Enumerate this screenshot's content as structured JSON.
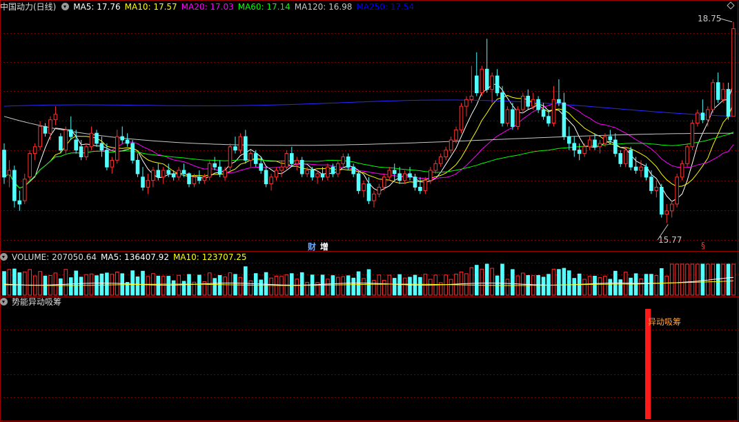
{
  "header": {
    "title": "中国动力(日线)",
    "ma": [
      {
        "label": "MA5: 17.76",
        "color": "#ffffff"
      },
      {
        "label": "MA10: 17.57",
        "color": "#ffff00"
      },
      {
        "label": "MA20: 17.03",
        "color": "#ff00ff"
      },
      {
        "label": "MA60: 17.14",
        "color": "#00ff00"
      },
      {
        "label": "MA120: 16.98",
        "color": "#c8c8c8"
      },
      {
        "label": "MA250: 17.54",
        "color": "#0000ff"
      }
    ]
  },
  "volume_header": {
    "label": "VOLUME: 207050.64",
    "ma5": "MA5: 136407.92",
    "ma10": "MA10: 123707.25"
  },
  "indicator_header": {
    "label": "势能异动吸筹"
  },
  "annotations": {
    "high": "18.75",
    "low": "15.77",
    "cai": "财",
    "zeng": "增",
    "s": "§",
    "signal": "异动吸筹"
  },
  "colors": {
    "up": "#ff3232",
    "down": "#54ffff",
    "grid": "#7a0000",
    "border": "#a00000"
  },
  "chart_data": {
    "type": "candlestick",
    "title": "中国动力(日线)",
    "y_high_label": 18.75,
    "y_low_label": 15.77,
    "candles": [
      [
        16.85,
        16.95,
        16.35,
        16.45
      ],
      [
        16.48,
        16.7,
        16.3,
        16.55
      ],
      [
        16.55,
        16.62,
        16.0,
        16.1
      ],
      [
        16.1,
        16.25,
        15.95,
        16.05
      ],
      [
        16.1,
        16.5,
        16.05,
        16.42
      ],
      [
        16.45,
        16.85,
        16.4,
        16.8
      ],
      [
        16.8,
        16.95,
        16.7,
        16.9
      ],
      [
        16.9,
        17.28,
        16.85,
        17.2
      ],
      [
        17.2,
        17.25,
        17.05,
        17.1
      ],
      [
        17.1,
        17.35,
        17.0,
        17.3
      ],
      [
        17.3,
        17.5,
        17.22,
        17.38
      ],
      [
        17.05,
        17.1,
        16.8,
        16.85
      ],
      [
        16.85,
        17.2,
        16.8,
        17.15
      ],
      [
        17.15,
        17.35,
        17.0,
        17.05
      ],
      [
        17.0,
        17.15,
        16.8,
        16.85
      ],
      [
        16.9,
        17.0,
        16.7,
        16.75
      ],
      [
        16.75,
        16.95,
        16.7,
        16.9
      ],
      [
        16.9,
        17.2,
        16.85,
        17.1
      ],
      [
        17.1,
        17.15,
        16.9,
        16.95
      ],
      [
        16.95,
        17.05,
        16.75,
        16.85
      ],
      [
        16.85,
        16.95,
        16.55,
        16.6
      ],
      [
        16.6,
        16.75,
        16.5,
        16.7
      ],
      [
        16.7,
        17.15,
        16.65,
        17.05
      ],
      [
        17.05,
        17.2,
        16.95,
        17.0
      ],
      [
        17.0,
        17.1,
        16.9,
        16.95
      ],
      [
        16.95,
        17.0,
        16.65,
        16.7
      ],
      [
        16.7,
        16.8,
        16.45,
        16.5
      ],
      [
        16.45,
        16.6,
        16.25,
        16.3
      ],
      [
        16.3,
        16.5,
        16.2,
        16.4
      ],
      [
        16.4,
        16.6,
        16.3,
        16.55
      ],
      [
        16.55,
        16.65,
        16.4,
        16.45
      ],
      [
        16.45,
        16.6,
        16.35,
        16.55
      ],
      [
        16.55,
        16.65,
        16.45,
        16.5
      ],
      [
        16.5,
        16.55,
        16.4,
        16.45
      ],
      [
        16.45,
        16.6,
        16.4,
        16.55
      ],
      [
        16.55,
        16.65,
        16.45,
        16.5
      ],
      [
        16.5,
        16.52,
        16.3,
        16.35
      ],
      [
        16.35,
        16.5,
        16.3,
        16.45
      ],
      [
        16.45,
        16.55,
        16.35,
        16.4
      ],
      [
        16.4,
        16.5,
        16.35,
        16.45
      ],
      [
        16.45,
        16.7,
        16.4,
        16.65
      ],
      [
        16.65,
        16.75,
        16.55,
        16.6
      ],
      [
        16.6,
        16.7,
        16.45,
        16.5
      ],
      [
        16.45,
        16.6,
        16.4,
        16.55
      ],
      [
        16.6,
        16.95,
        16.55,
        16.9
      ],
      [
        16.9,
        17.05,
        16.8,
        16.85
      ],
      [
        16.85,
        17.1,
        16.8,
        17.05
      ],
      [
        17.05,
        17.15,
        16.65,
        16.7
      ],
      [
        16.7,
        16.85,
        16.6,
        16.8
      ],
      [
        16.8,
        16.85,
        16.6,
        16.65
      ],
      [
        16.65,
        16.75,
        16.5,
        16.55
      ],
      [
        16.55,
        16.6,
        16.3,
        16.35
      ],
      [
        16.35,
        16.5,
        16.25,
        16.45
      ],
      [
        16.45,
        16.6,
        16.4,
        16.55
      ],
      [
        16.55,
        16.7,
        16.45,
        16.6
      ],
      [
        16.6,
        16.85,
        16.55,
        16.8
      ],
      [
        16.8,
        16.9,
        16.6,
        16.65
      ],
      [
        16.65,
        16.75,
        16.55,
        16.7
      ],
      [
        16.7,
        16.75,
        16.45,
        16.5
      ],
      [
        16.5,
        16.6,
        16.45,
        16.55
      ],
      [
        16.55,
        16.6,
        16.4,
        16.45
      ],
      [
        16.45,
        16.55,
        16.35,
        16.5
      ],
      [
        16.5,
        16.6,
        16.4,
        16.45
      ],
      [
        16.45,
        16.65,
        16.4,
        16.6
      ],
      [
        16.6,
        16.65,
        16.45,
        16.5
      ],
      [
        16.5,
        16.7,
        16.45,
        16.65
      ],
      [
        16.65,
        16.8,
        16.6,
        16.75
      ],
      [
        16.75,
        16.8,
        16.55,
        16.6
      ],
      [
        16.6,
        16.65,
        16.45,
        16.5
      ],
      [
        16.5,
        16.55,
        16.2,
        16.25
      ],
      [
        16.25,
        16.4,
        16.15,
        16.35
      ],
      [
        16.35,
        16.45,
        16.05,
        16.1
      ],
      [
        16.1,
        16.25,
        16.0,
        16.2
      ],
      [
        16.2,
        16.35,
        16.15,
        16.3
      ],
      [
        16.3,
        16.5,
        16.25,
        16.45
      ],
      [
        16.45,
        16.6,
        16.4,
        16.55
      ],
      [
        16.55,
        16.65,
        16.4,
        16.5
      ],
      [
        16.5,
        16.6,
        16.35,
        16.4
      ],
      [
        16.4,
        16.55,
        16.35,
        16.5
      ],
      [
        16.5,
        16.6,
        16.4,
        16.45
      ],
      [
        16.45,
        16.5,
        16.25,
        16.3
      ],
      [
        16.3,
        16.45,
        16.2,
        16.25
      ],
      [
        16.25,
        16.45,
        16.2,
        16.4
      ],
      [
        16.4,
        16.6,
        16.35,
        16.55
      ],
      [
        16.55,
        16.7,
        16.5,
        16.65
      ],
      [
        16.65,
        16.8,
        16.6,
        16.75
      ],
      [
        16.75,
        16.9,
        16.7,
        16.85
      ],
      [
        16.85,
        17.05,
        16.8,
        17.0
      ],
      [
        17.0,
        17.2,
        16.95,
        17.15
      ],
      [
        17.15,
        17.55,
        17.1,
        17.5
      ],
      [
        17.5,
        17.65,
        17.35,
        17.6
      ],
      [
        17.6,
        18.1,
        17.55,
        17.65
      ],
      [
        17.95,
        18.3,
        17.65,
        17.7
      ],
      [
        17.7,
        18.1,
        17.65,
        18.05
      ],
      [
        18.05,
        18.5,
        17.7,
        17.75
      ],
      [
        17.75,
        18.0,
        17.55,
        17.95
      ],
      [
        17.95,
        18.05,
        17.65,
        17.7
      ],
      [
        17.7,
        17.8,
        17.2,
        17.25
      ],
      [
        17.25,
        17.5,
        17.2,
        17.45
      ],
      [
        17.45,
        17.55,
        17.15,
        17.2
      ],
      [
        17.2,
        17.5,
        17.15,
        17.45
      ],
      [
        17.45,
        17.7,
        17.4,
        17.65
      ],
      [
        17.65,
        17.75,
        17.45,
        17.5
      ],
      [
        17.5,
        17.7,
        17.45,
        17.6
      ],
      [
        17.6,
        17.65,
        17.4,
        17.45
      ],
      [
        17.45,
        17.55,
        17.3,
        17.35
      ],
      [
        17.35,
        17.45,
        17.2,
        17.25
      ],
      [
        17.25,
        17.8,
        17.2,
        17.6
      ],
      [
        17.6,
        17.9,
        17.5,
        17.55
      ],
      [
        17.55,
        17.7,
        17.0,
        17.05
      ],
      [
        17.05,
        17.2,
        16.85,
        16.95
      ],
      [
        16.95,
        17.05,
        16.75,
        16.85
      ],
      [
        16.85,
        16.95,
        16.7,
        16.8
      ],
      [
        16.8,
        16.95,
        16.75,
        16.9
      ],
      [
        16.9,
        17.05,
        16.85,
        17.0
      ],
      [
        17.0,
        17.1,
        16.85,
        16.9
      ],
      [
        16.9,
        17.0,
        16.8,
        16.95
      ],
      [
        16.95,
        17.1,
        16.9,
        17.05
      ],
      [
        17.05,
        17.15,
        16.95,
        17.0
      ],
      [
        17.0,
        17.1,
        16.75,
        16.8
      ],
      [
        16.8,
        16.85,
        16.6,
        16.65
      ],
      [
        16.65,
        16.9,
        16.6,
        16.85
      ],
      [
        16.85,
        16.9,
        16.55,
        16.6
      ],
      [
        16.6,
        16.75,
        16.5,
        16.55
      ],
      [
        16.55,
        16.7,
        16.45,
        16.6
      ],
      [
        16.6,
        16.65,
        16.4,
        16.45
      ],
      [
        16.45,
        16.55,
        16.2,
        16.25
      ],
      [
        16.25,
        16.4,
        16.15,
        16.3
      ],
      [
        16.3,
        16.35,
        15.85,
        15.9
      ],
      [
        15.9,
        16.05,
        15.77,
        15.95
      ],
      [
        15.95,
        16.1,
        15.85,
        16.05
      ],
      [
        16.05,
        16.5,
        16.0,
        16.45
      ],
      [
        16.45,
        16.7,
        16.4,
        16.65
      ],
      [
        16.65,
        16.95,
        16.6,
        16.9
      ],
      [
        16.9,
        17.3,
        16.85,
        17.25
      ],
      [
        17.25,
        17.45,
        17.2,
        17.4
      ],
      [
        17.4,
        17.6,
        17.25,
        17.3
      ],
      [
        17.3,
        17.5,
        17.2,
        17.45
      ],
      [
        17.45,
        17.9,
        17.4,
        17.85
      ],
      [
        17.85,
        18.0,
        17.55,
        17.6
      ],
      [
        17.6,
        17.85,
        17.55,
        17.75
      ],
      [
        17.75,
        17.85,
        17.3,
        17.35
      ],
      [
        17.35,
        18.75,
        17.35,
        18.65
      ]
    ],
    "volume_ma5": 136407.92,
    "volume_ma10": 123707.25,
    "last_volume": 207050.64,
    "signal_label": "异动吸筹"
  }
}
